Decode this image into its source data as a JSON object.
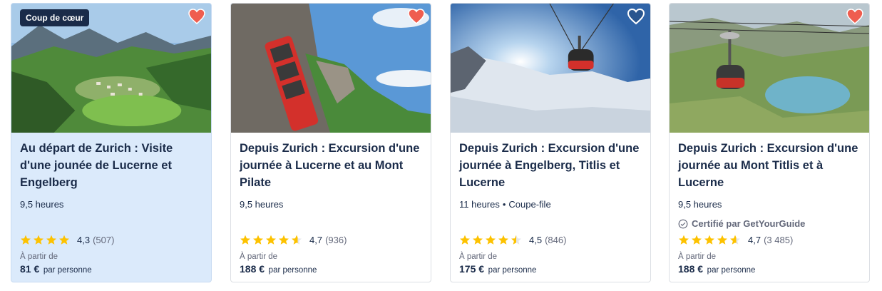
{
  "cards": [
    {
      "badge": "Coup de cœur",
      "title": "Au départ de Zurich : Visite d'une jounée de Lucerne et Engelberg",
      "duration": "9,5 heures",
      "rating": "4,3",
      "reviews": "(507)",
      "from_label": "À partir de",
      "price": "81 €",
      "per": "par personne",
      "favorited": true
    },
    {
      "title": "Depuis Zurich : Excursion d'une journée à Lucerne et au Mont Pilate",
      "duration": "9,5 heures",
      "rating": "4,7",
      "reviews": "(936)",
      "from_label": "À partir de",
      "price": "188 €",
      "per": "par personne",
      "favorited": true
    },
    {
      "title": "Depuis Zurich : Excursion d'une journée à Engelberg, Titlis et Lucerne",
      "duration": "11 heures",
      "extra": "Coupe-file",
      "rating": "4,5",
      "reviews": "(846)",
      "from_label": "À partir de",
      "price": "175 €",
      "per": "par personne",
      "favorited": false
    },
    {
      "title": "Depuis Zurich : Excursion d'une journée au Mont Titlis et à Lucerne",
      "duration": "9,5 heures",
      "certified": "Certifié par GetYourGuide",
      "rating": "4,7",
      "reviews": "(3 485)",
      "from_label": "À partir de",
      "price": "188 €",
      "per": "par personne",
      "favorited": true
    }
  ],
  "colors": {
    "heart": "#ef5d4f",
    "star": "#fdc200",
    "navy": "#1a2b49",
    "highlight_bg": "#dbeafb"
  }
}
